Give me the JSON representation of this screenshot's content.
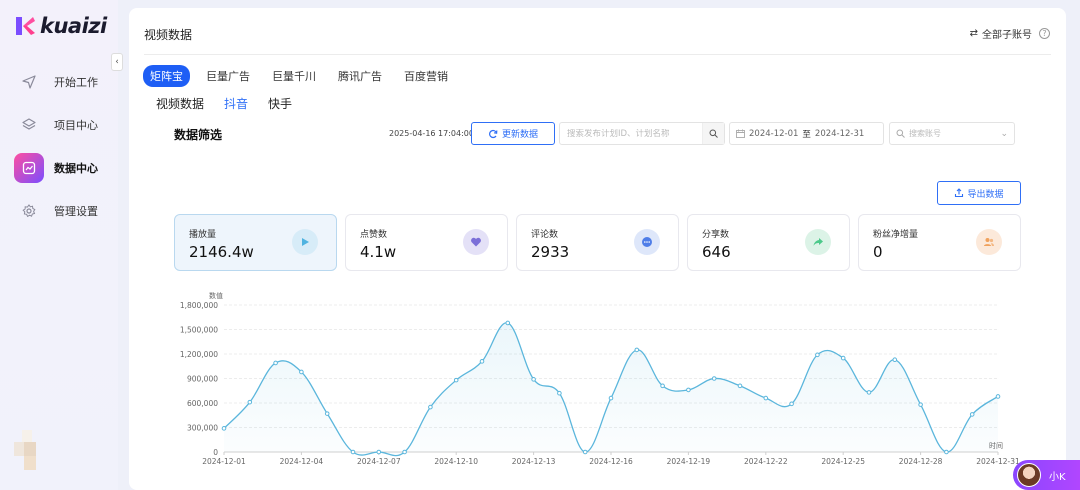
{
  "brand": {
    "name": "kuaizi"
  },
  "sidebar": {
    "items": [
      {
        "label": "开始工作",
        "icon": "send-icon",
        "active": false
      },
      {
        "label": "项目中心",
        "icon": "layers-icon",
        "active": false
      },
      {
        "label": "数据中心",
        "icon": "chart-icon",
        "active": true
      },
      {
        "label": "管理设置",
        "icon": "gear-icon",
        "active": false
      }
    ]
  },
  "header": {
    "title": "视频数据",
    "account_switch": "全部子账号"
  },
  "platform_tabs": [
    "矩阵宝",
    "巨量广告",
    "巨量千川",
    "腾讯广告",
    "百度营销"
  ],
  "sub_tabs": [
    "视频数据",
    "抖音",
    "快手"
  ],
  "filter": {
    "title": "数据筛选",
    "timestamp": "2025-04-16 17:04:00",
    "refresh_label": "更新数据",
    "search_placeholder": "搜索发布计划ID、计划名称",
    "date_start": "2024-12-01",
    "date_sep": "至",
    "date_end": "2024-12-31",
    "account_placeholder": "搜索账号"
  },
  "export_label": "导出数据",
  "stats": [
    {
      "label": "播放量",
      "value": "2146.4w",
      "icon": "play-icon",
      "color": "#4fb3e0",
      "bg": "#d7ecf8"
    },
    {
      "label": "点赞数",
      "value": "4.1w",
      "icon": "heart-icon",
      "color": "#7b6fd8",
      "bg": "#e4e1f7"
    },
    {
      "label": "评论数",
      "value": "2933",
      "icon": "comment-icon",
      "color": "#4f7ee8",
      "bg": "#dee7fa"
    },
    {
      "label": "分享数",
      "value": "646",
      "icon": "share-icon",
      "color": "#4cc98a",
      "bg": "#dcf3e7"
    },
    {
      "label": "粉丝净增量",
      "value": "0",
      "icon": "users-icon",
      "color": "#f0a15c",
      "bg": "#fce9da"
    }
  ],
  "chart_data": {
    "type": "line",
    "ylabel": "数值",
    "xlabel": "时间",
    "ylim": [
      0,
      1800000
    ],
    "yticks": [
      "0",
      "300,000",
      "600,000",
      "900,000",
      "1,200,000",
      "1,500,000",
      "1,800,000"
    ],
    "xtick_labels": [
      "2024-12-01",
      "2024-12-04",
      "2024-12-07",
      "2024-12-10",
      "2024-12-13",
      "2024-12-16",
      "2024-12-19",
      "2024-12-22",
      "2024-12-25",
      "2024-12-28",
      "2024-12-31"
    ],
    "x": [
      "2024-12-01",
      "2024-12-02",
      "2024-12-03",
      "2024-12-04",
      "2024-12-05",
      "2024-12-06",
      "2024-12-07",
      "2024-12-08",
      "2024-12-09",
      "2024-12-10",
      "2024-12-11",
      "2024-12-12",
      "2024-12-13",
      "2024-12-14",
      "2024-12-15",
      "2024-12-16",
      "2024-12-17",
      "2024-12-18",
      "2024-12-19",
      "2024-12-20",
      "2024-12-21",
      "2024-12-22",
      "2024-12-23",
      "2024-12-24",
      "2024-12-25",
      "2024-12-26",
      "2024-12-27",
      "2024-12-28",
      "2024-12-29",
      "2024-12-30",
      "2024-12-31"
    ],
    "series": [
      {
        "color": "#5bb6dc",
        "values": [
          290000,
          610000,
          1090000,
          980000,
          470000,
          0,
          0,
          0,
          550000,
          880000,
          1110000,
          1580000,
          890000,
          720000,
          0,
          660000,
          1250000,
          810000,
          760000,
          900000,
          810000,
          660000,
          590000,
          1190000,
          1150000,
          730000,
          1130000,
          580000,
          0,
          460000,
          680000
        ]
      }
    ],
    "grid": true
  },
  "assistant": {
    "label": "小K"
  }
}
